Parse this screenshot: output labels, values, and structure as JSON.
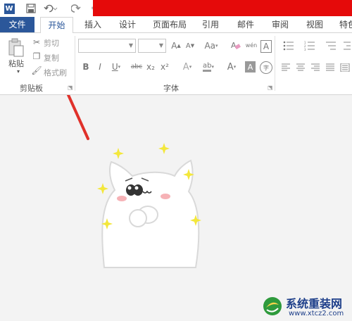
{
  "quick_access": {
    "logo_letter": "W",
    "more_glyph": "="
  },
  "tabs": [
    {
      "label": "文件"
    },
    {
      "label": "开始"
    },
    {
      "label": "插入"
    },
    {
      "label": "设计"
    },
    {
      "label": "页面布局"
    },
    {
      "label": "引用"
    },
    {
      "label": "邮件"
    },
    {
      "label": "审阅"
    },
    {
      "label": "视图"
    },
    {
      "label": "特色"
    }
  ],
  "clipboard": {
    "paste": "粘贴",
    "cut": "剪切",
    "copy": "复制",
    "format_painter": "格式刷",
    "group_label": "剪贴板"
  },
  "font": {
    "group_label": "字体",
    "grow": "A",
    "shrink": "A",
    "change_case": "Aa",
    "phonetic": "wén",
    "border_char": "A",
    "bold": "B",
    "italic": "I",
    "underline": "U",
    "strike": "abc",
    "sub": "x₂",
    "sup": "x²",
    "effects": "A",
    "highlight": "ab",
    "font_color": "A",
    "shading": "A",
    "enclose": "字"
  },
  "colors": {
    "file_tab": "#2b579a",
    "redbar": "#e50a0a",
    "arrow": "#e0312a",
    "logo_green": "#2e9a3c"
  },
  "watermark": {
    "title": "系统重装网",
    "url": "www.xtcz2.com"
  }
}
